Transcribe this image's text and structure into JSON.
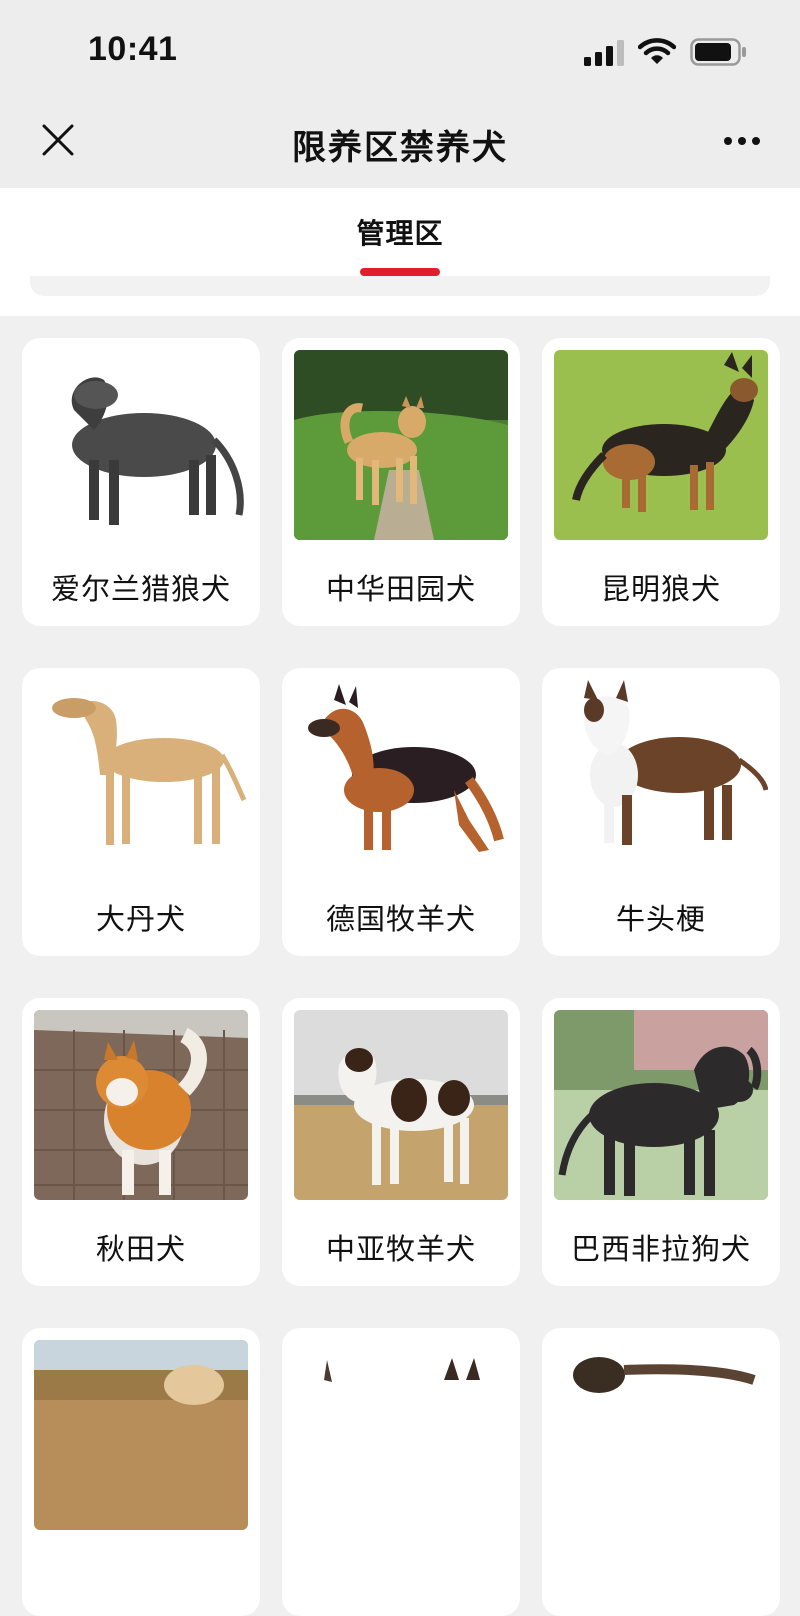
{
  "status_bar": {
    "time": "10:41"
  },
  "nav": {
    "title": "限养区禁养犬",
    "close_icon": "close-icon",
    "more_icon": "more-icon"
  },
  "tabs": [
    {
      "label": "管理区",
      "active": true
    }
  ],
  "colors": {
    "accent": "#e01e2d",
    "background": "#f0f0f0",
    "card": "#ffffff"
  },
  "breeds": [
    {
      "name": "爱尔兰猎狼犬"
    },
    {
      "name": "中华田园犬"
    },
    {
      "name": "昆明狼犬"
    },
    {
      "name": "大丹犬"
    },
    {
      "name": "德国牧羊犬"
    },
    {
      "name": "牛头梗"
    },
    {
      "name": "秋田犬"
    },
    {
      "name": "中亚牧羊犬"
    },
    {
      "name": "巴西非拉狗犬"
    }
  ]
}
